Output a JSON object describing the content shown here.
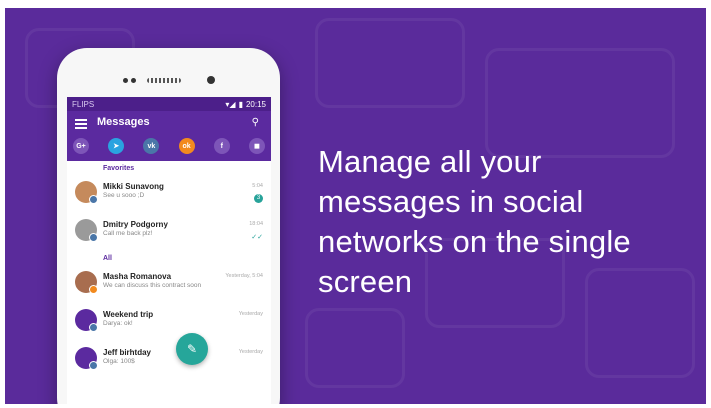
{
  "headline": "Manage all your messages in social networks on the single screen",
  "status_bar": {
    "carrier": "FLIPS",
    "time": "20:15",
    "signal_icon": "signal-icon",
    "battery_icon": "battery-icon"
  },
  "app_bar": {
    "title": "Messages",
    "menu_icon": "menu-icon",
    "search_icon": "search-icon"
  },
  "networks": [
    {
      "name": "google-plus",
      "label": "G+",
      "color": "#7d55b8"
    },
    {
      "name": "telegram",
      "label": "➤",
      "color": "#2aa3e0"
    },
    {
      "name": "vk",
      "label": "vk",
      "color": "#4a76a8"
    },
    {
      "name": "odnoklassniki",
      "label": "ok",
      "color": "#f28a1e"
    },
    {
      "name": "facebook",
      "label": "f",
      "color": "#7d55b8"
    },
    {
      "name": "other",
      "label": "◼",
      "color": "#7d55b8"
    }
  ],
  "sections": {
    "favorites": "Favorites",
    "all": "All"
  },
  "favorites": [
    {
      "name": "Mikki Sunavong",
      "preview": "See u sooo ;D",
      "time": "5:04",
      "count": "3",
      "avatar_color": "#c58a5c",
      "badge_color": "#4a76a8"
    },
    {
      "name": "Dmitry Podgorny",
      "preview": "Call me back plz!",
      "time": "18:04",
      "ticks": "✓✓",
      "avatar_color": "#9a9a9a",
      "badge_color": "#4a76a8"
    }
  ],
  "all": [
    {
      "name": "Masha Romanova",
      "preview": "We can discuss this contract soon",
      "time": "Yesterday, 5:04",
      "avatar_color": "#a86d4f",
      "badge_color": "#f28a1e"
    },
    {
      "name": "Weekend trip",
      "preview": "Darya: ok!",
      "time": "Yesterday",
      "avatar_color": "#5b2a9f",
      "badge_color": "#4a76a8"
    },
    {
      "name": "Jeff birhtday",
      "preview": "Olga: 100$",
      "time": "Yesterday",
      "avatar_color": "#5b2a9f",
      "badge_color": "#4a76a8"
    }
  ],
  "fab_icon": "pencil-icon"
}
